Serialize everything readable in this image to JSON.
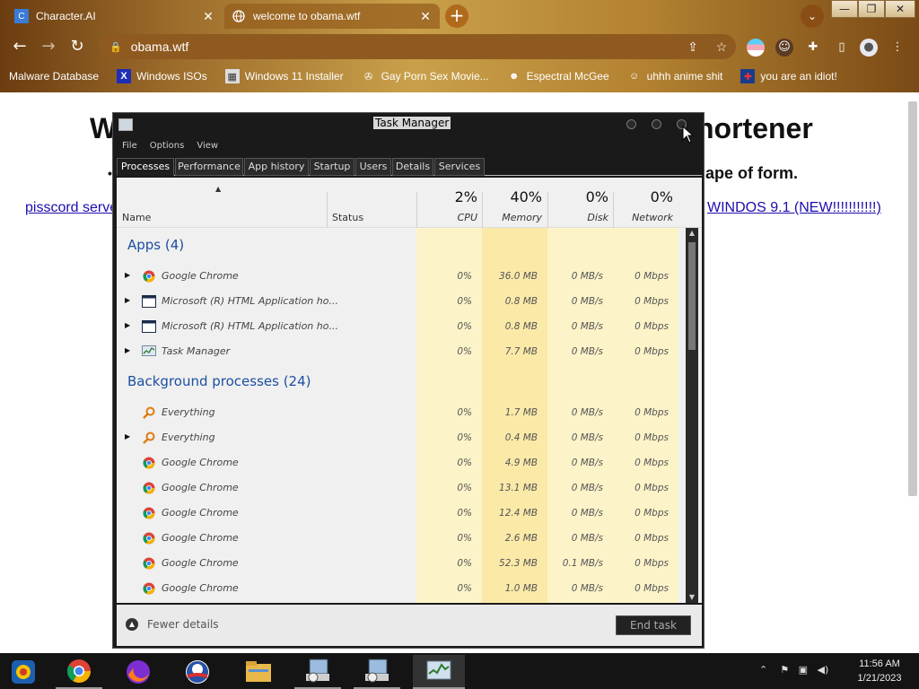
{
  "browser": {
    "tabs": [
      {
        "title": "Character.AI",
        "close": "✕"
      },
      {
        "title": "welcome to obama.wtf",
        "close": "✕"
      }
    ],
    "new_tab": "+",
    "url": "obama.wtf",
    "bookmarks": [
      "Malware Database",
      "Windows ISOs",
      "Windows 11 Installer",
      "Gay Porn Sex Movie...",
      "Espectral McGee",
      "uhhh anime shit",
      "you are an idiot!"
    ]
  },
  "page": {
    "title_left": "W",
    "title_right": "hortener",
    "subtitle_right": "ape of form.",
    "link_left": "pisscord serve",
    "link_right": "WINDOS 9.1 (NEW!!!!!!!!!!!)"
  },
  "task_manager": {
    "title": "Task Manager",
    "menu": [
      "File",
      "Options",
      "View"
    ],
    "tabs": [
      "Processes",
      "Performance",
      "App history",
      "Startup",
      "Users",
      "Details",
      "Services"
    ],
    "columns": {
      "name": "Name",
      "status": "Status",
      "cpu_pct": "2%",
      "cpu": "CPU",
      "memory_pct": "40%",
      "memory": "Memory",
      "disk_pct": "0%",
      "disk": "Disk",
      "network_pct": "0%",
      "network": "Network"
    },
    "apps_header": "Apps (4)",
    "apps": [
      {
        "name": "Google Chrome",
        "icon": "chrome-icon",
        "cpu": "0%",
        "mem": "36.0 MB",
        "disk": "0 MB/s",
        "net": "0 Mbps"
      },
      {
        "name": "Microsoft (R) HTML Application ho...",
        "icon": "window-icon",
        "cpu": "0%",
        "mem": "0.8 MB",
        "disk": "0 MB/s",
        "net": "0 Mbps"
      },
      {
        "name": "Microsoft (R) HTML Application ho...",
        "icon": "window-icon",
        "cpu": "0%",
        "mem": "0.8 MB",
        "disk": "0 MB/s",
        "net": "0 Mbps"
      },
      {
        "name": "Task Manager",
        "icon": "taskmgr-icon",
        "cpu": "0%",
        "mem": "7.7 MB",
        "disk": "0 MB/s",
        "net": "0 Mbps"
      }
    ],
    "bg_header": "Background processes (24)",
    "background": [
      {
        "name": "Everything",
        "icon": "search-icon",
        "exp": false,
        "cpu": "0%",
        "mem": "1.7 MB",
        "disk": "0 MB/s",
        "net": "0 Mbps"
      },
      {
        "name": "Everything",
        "icon": "search-icon",
        "exp": true,
        "cpu": "0%",
        "mem": "0.4 MB",
        "disk": "0 MB/s",
        "net": "0 Mbps"
      },
      {
        "name": "Google Chrome",
        "icon": "chrome-icon",
        "exp": false,
        "cpu": "0%",
        "mem": "4.9 MB",
        "disk": "0 MB/s",
        "net": "0 Mbps"
      },
      {
        "name": "Google Chrome",
        "icon": "chrome-icon",
        "exp": false,
        "cpu": "0%",
        "mem": "13.1 MB",
        "disk": "0 MB/s",
        "net": "0 Mbps"
      },
      {
        "name": "Google Chrome",
        "icon": "chrome-icon",
        "exp": false,
        "cpu": "0%",
        "mem": "12.4 MB",
        "disk": "0 MB/s",
        "net": "0 Mbps"
      },
      {
        "name": "Google Chrome",
        "icon": "chrome-icon",
        "exp": false,
        "cpu": "0%",
        "mem": "2.6 MB",
        "disk": "0 MB/s",
        "net": "0 Mbps"
      },
      {
        "name": "Google Chrome",
        "icon": "chrome-icon",
        "exp": false,
        "cpu": "0%",
        "mem": "52.3 MB",
        "disk": "0.1 MB/s",
        "net": "0 Mbps"
      },
      {
        "name": "Google Chrome",
        "icon": "chrome-icon",
        "exp": false,
        "cpu": "0%",
        "mem": "1.0 MB",
        "disk": "0 MB/s",
        "net": "0 Mbps"
      }
    ],
    "fewer_details": "Fewer details",
    "end_task": "End task"
  },
  "taskbar": {
    "time": "11:56 AM",
    "date": "1/21/2023"
  }
}
